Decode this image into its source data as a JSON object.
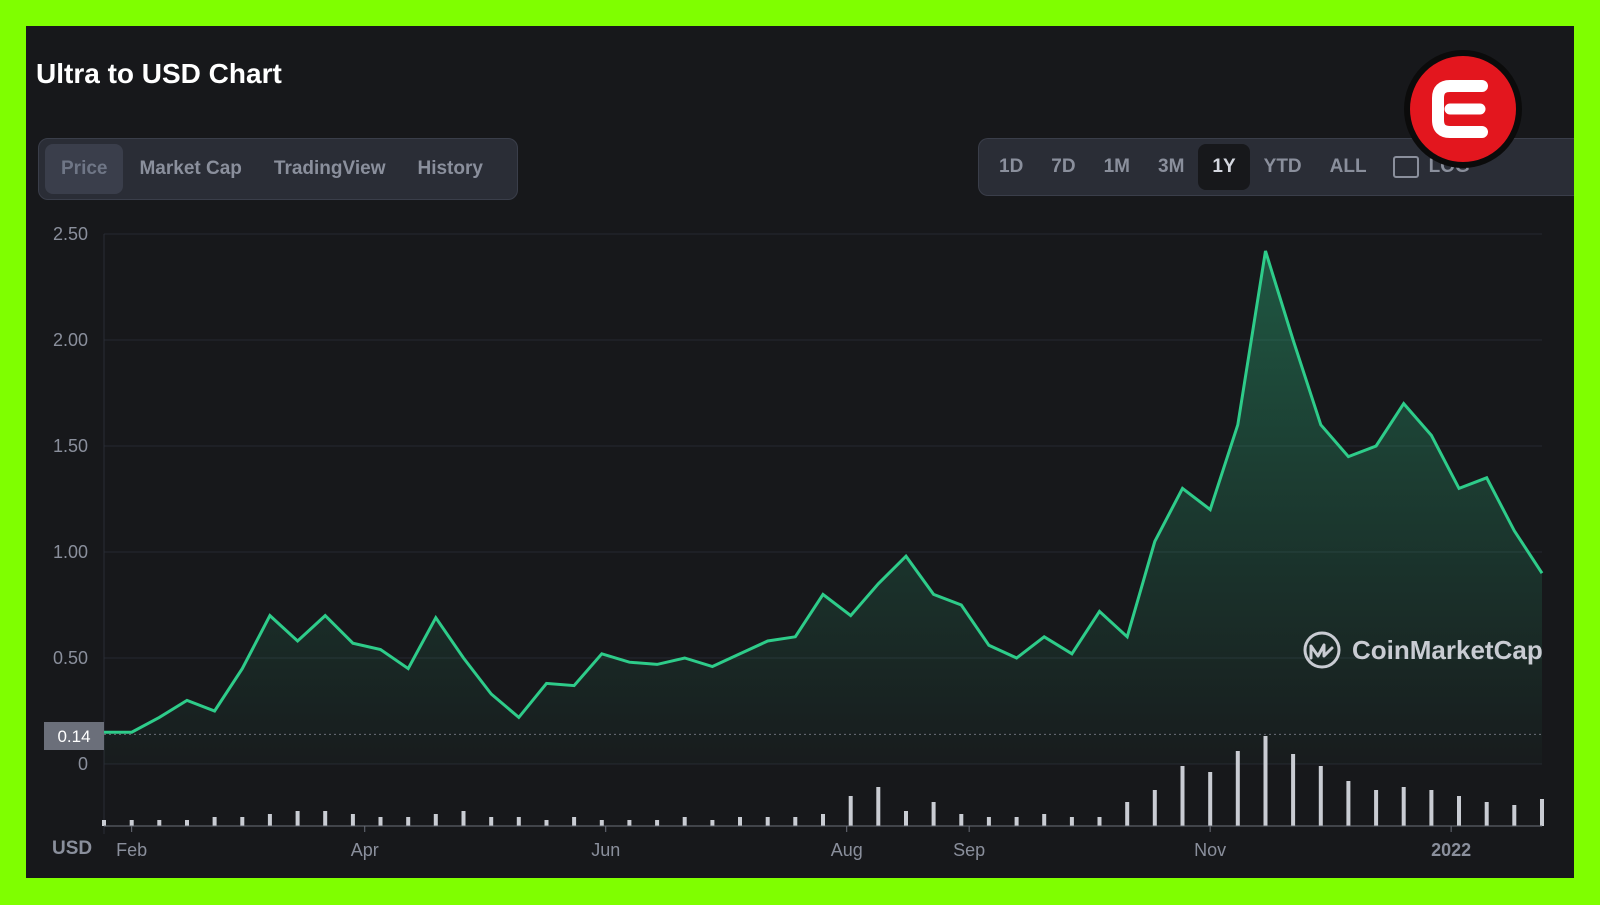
{
  "title": "Ultra to USD Chart",
  "tabs_left": [
    "Price",
    "Market Cap",
    "TradingView",
    "History"
  ],
  "tabs_left_active": "Price",
  "tabs_right": [
    "1D",
    "7D",
    "1M",
    "3M",
    "1Y",
    "YTD",
    "ALL"
  ],
  "tabs_right_active": "1Y",
  "log_label": "LOG",
  "watermark": "CoinMarketCap",
  "colors": {
    "line": "#2ecc8a",
    "background": "#17181b",
    "frame": "#7fff00",
    "badge": "#e3161e"
  },
  "chart_data": {
    "type": "line",
    "currency_label": "USD",
    "y_ticks": [
      "2.50",
      "2.00",
      "1.50",
      "1.00",
      "0.50",
      "0"
    ],
    "ylim": [
      0,
      2.5
    ],
    "current_price_label": "0.14",
    "x_ticks": [
      "Feb",
      "Apr",
      "Jun",
      "Aug",
      "Sep",
      "Nov",
      "2022"
    ],
    "x": [
      "2021-01-25",
      "2021-02-01",
      "2021-02-08",
      "2021-02-15",
      "2021-02-22",
      "2021-03-01",
      "2021-03-08",
      "2021-03-15",
      "2021-03-22",
      "2021-03-29",
      "2021-04-05",
      "2021-04-12",
      "2021-04-19",
      "2021-04-26",
      "2021-05-03",
      "2021-05-10",
      "2021-05-17",
      "2021-05-24",
      "2021-05-31",
      "2021-06-07",
      "2021-06-14",
      "2021-06-21",
      "2021-06-28",
      "2021-07-05",
      "2021-07-12",
      "2021-07-19",
      "2021-07-26",
      "2021-08-02",
      "2021-08-09",
      "2021-08-16",
      "2021-08-23",
      "2021-08-30",
      "2021-09-06",
      "2021-09-13",
      "2021-09-20",
      "2021-09-27",
      "2021-10-04",
      "2021-10-11",
      "2021-10-18",
      "2021-10-25",
      "2021-11-01",
      "2021-11-08",
      "2021-11-15",
      "2021-11-22",
      "2021-11-29",
      "2021-12-06",
      "2021-12-13",
      "2021-12-20",
      "2021-12-27",
      "2022-01-03",
      "2022-01-10",
      "2022-01-17",
      "2022-01-24"
    ],
    "series": [
      {
        "values": [
          0.15,
          0.15,
          0.22,
          0.3,
          0.25,
          0.45,
          0.7,
          0.58,
          0.7,
          0.57,
          0.54,
          0.45,
          0.69,
          0.5,
          0.33,
          0.22,
          0.38,
          0.37,
          0.52,
          0.48,
          0.47,
          0.5,
          0.46,
          0.52,
          0.58,
          0.6,
          0.8,
          0.7,
          0.85,
          0.98,
          0.8,
          0.75,
          0.56,
          0.5,
          0.6,
          0.52,
          0.72,
          0.6,
          1.05,
          1.3,
          1.2,
          1.6,
          2.42,
          2.0,
          1.6,
          1.45,
          1.5,
          1.7,
          1.55,
          1.3,
          1.35,
          1.1,
          0.9
        ]
      },
      {
        "name": "volume",
        "values": [
          0.02,
          0.02,
          0.02,
          0.02,
          0.03,
          0.03,
          0.04,
          0.05,
          0.05,
          0.04,
          0.03,
          0.03,
          0.04,
          0.05,
          0.03,
          0.03,
          0.02,
          0.03,
          0.02,
          0.02,
          0.02,
          0.03,
          0.02,
          0.03,
          0.03,
          0.03,
          0.04,
          0.1,
          0.13,
          0.05,
          0.08,
          0.04,
          0.03,
          0.03,
          0.04,
          0.03,
          0.03,
          0.08,
          0.12,
          0.2,
          0.18,
          0.25,
          0.3,
          0.24,
          0.2,
          0.15,
          0.12,
          0.13,
          0.12,
          0.1,
          0.08,
          0.07,
          0.09
        ]
      }
    ]
  }
}
